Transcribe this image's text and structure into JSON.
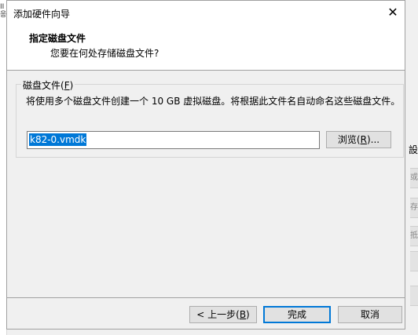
{
  "background": {
    "left_text": "II 응",
    "right_label": "設",
    "right_strips": [
      "或",
      "存",
      "抵",
      "",
      ""
    ]
  },
  "dialog": {
    "title": "添加硬件向导",
    "header": {
      "title": "指定磁盘文件",
      "subtitle": "您要在何处存储磁盘文件?"
    },
    "disk_file_group": {
      "legend_prefix": "磁盘文件(",
      "legend_key": "F",
      "legend_suffix": ")",
      "description": "将使用多个磁盘文件创建一个 10 GB 虚拟磁盘。将根据此文件名自动命名这些磁盘文件。",
      "file_value": "k82-0.vmdk",
      "browse_prefix": "浏览(",
      "browse_key": "R",
      "browse_suffix": ")..."
    },
    "buttons": {
      "back_prefix": "< 上一步(",
      "back_key": "B",
      "back_suffix": ")",
      "finish": "完成",
      "cancel": "取消"
    }
  }
}
